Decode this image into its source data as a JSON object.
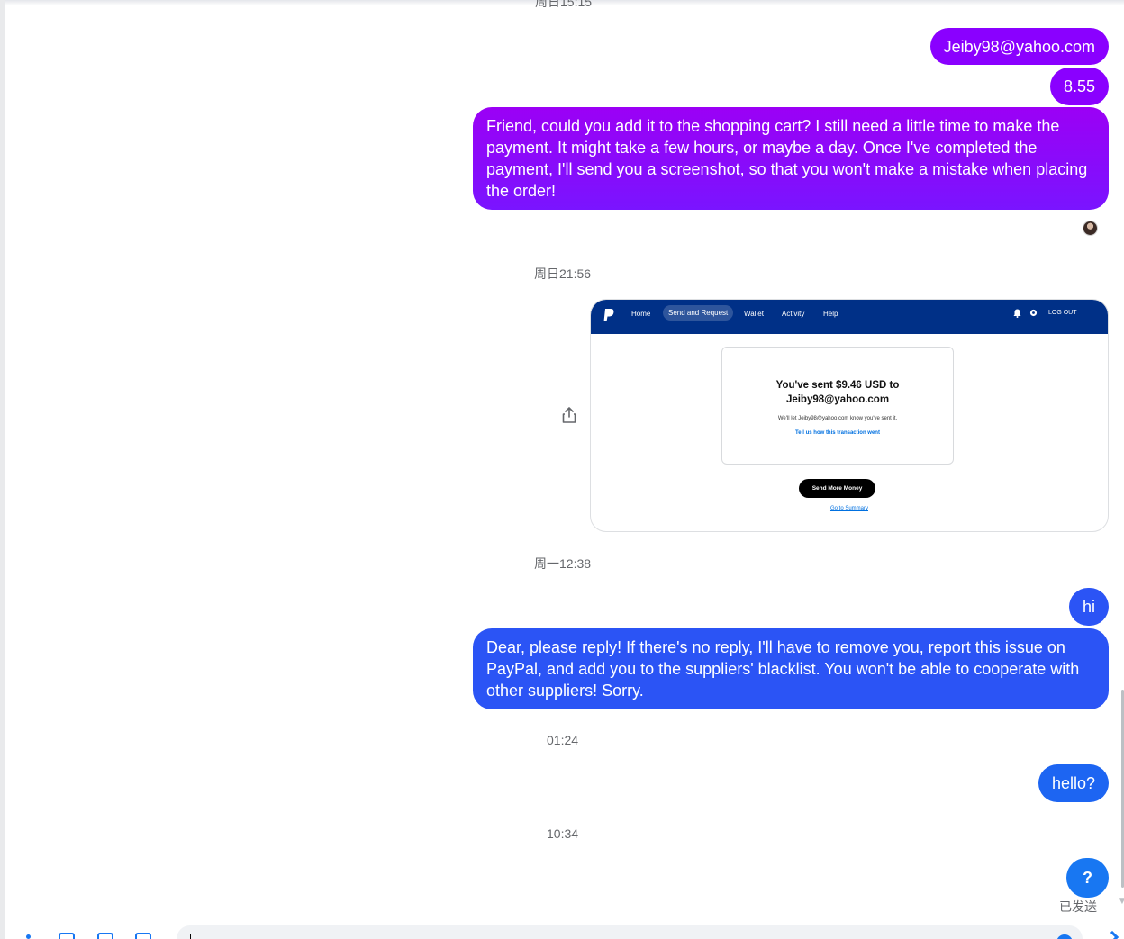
{
  "conversation": {
    "timestamps": {
      "top_cut": "周日15:15",
      "sun": "周日21:56",
      "mon": "周一12:38",
      "t0124": "01:24",
      "t1034": "10:34"
    },
    "messages": [
      {
        "text": "Jeiby98@yahoo.com"
      },
      {
        "text": "8.55"
      },
      {
        "text": "Friend, could you add it to the shopping cart? I still need a little time to make the payment. It might take a few hours, or maybe a day. Once I've completed the payment, I'll send you a screenshot, so that you won't make a mistake when placing the order!"
      },
      {
        "text": "hi"
      },
      {
        "text": "Dear, please reply! If there's no reply, I'll have to remove you, report this issue on PayPal, and add you to the suppliers' blacklist. You won't be able to cooperate with other suppliers! Sorry."
      },
      {
        "text": "hello?"
      },
      {
        "text": "?"
      }
    ],
    "status": "已发送"
  },
  "paypal_screenshot": {
    "nav": [
      "Home",
      "Send and Request",
      "Wallet",
      "Activity",
      "Help"
    ],
    "logout": "LOG OUT",
    "title_line1": "You've sent $9.46 USD to",
    "title_line2": "Jeiby98@yahoo.com",
    "note": "We'll let Jeiby98@yahoo.com know you've sent it.",
    "link": "Tell us how this transaction went",
    "send_button": "Send More Money",
    "summary_link": "Go to Summary"
  },
  "colors": {
    "bubble_purple": "#8a00ff",
    "bubble_blue": "#2b54f5",
    "bubble_blue_light": "#1d65f2",
    "accent": "#1877f2",
    "paypal_navy": "#003087"
  },
  "icons": {
    "share": "share-icon",
    "read_receipt": "avatar",
    "paypal_logo": "paypal-logo-icon"
  }
}
